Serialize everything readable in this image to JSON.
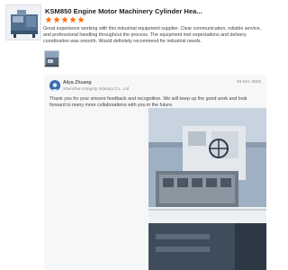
{
  "review": {
    "product_title": "KSM850 Engine Motor Machinery Cylinder Hea...",
    "rating": 5,
    "text": "Great experience working with this industrial equipment supplier. Clear communication, reliable service, and professional handling throughout the process. The equipment met expectations and delivery coordination was smooth. Would definitely recommend for industrial needs."
  },
  "reply": {
    "name": "Aliya Zhuang",
    "company": "Shenzhen Integrity Industry Co., Ltd",
    "date": "29 Dec 2025",
    "text": "Thank you for your sincere feedback and recognition. We will keep up the good work and look forward to many more collaborations with you in the future."
  },
  "colors": {
    "star": "#ff6a00",
    "reply_background": "#f6f7f9"
  }
}
